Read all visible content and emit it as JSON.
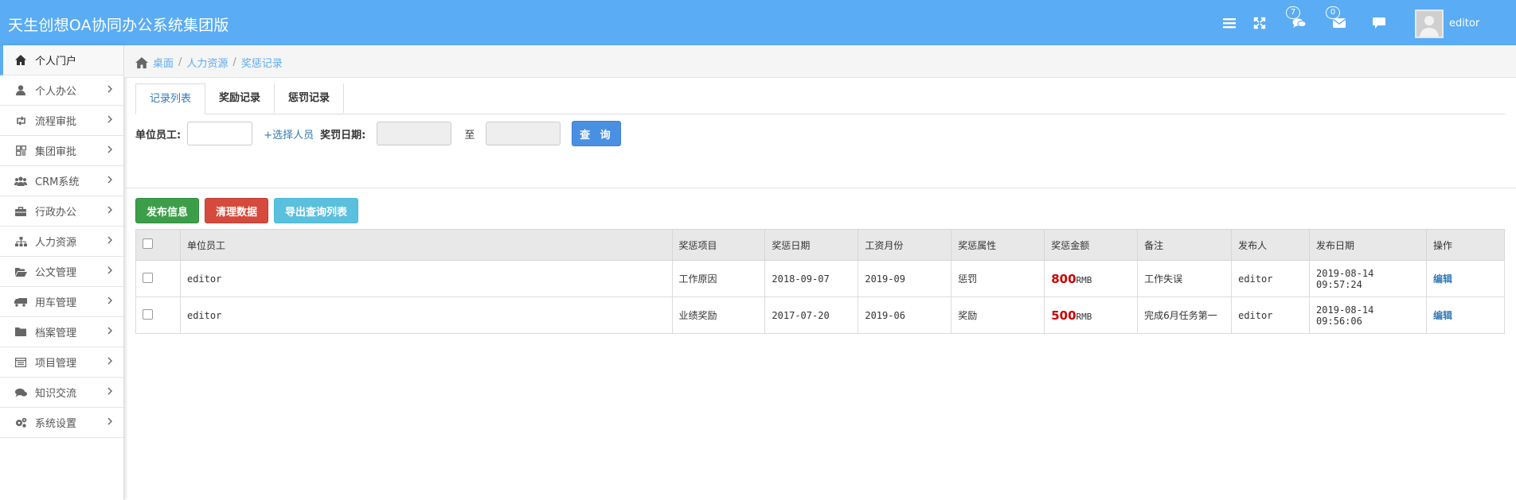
{
  "app": {
    "title": "天生创想OA协同办公系统集团版"
  },
  "header": {
    "icons": [
      "menu-icon",
      "fullscreen-icon",
      "chat-icon",
      "mail-icon",
      "message-icon"
    ],
    "chat_badge": "7",
    "mail_badge": "0",
    "user_name": "editor"
  },
  "sidebar": {
    "items": [
      {
        "label": "个人门户",
        "icon": "home-icon"
      },
      {
        "label": "个人办公",
        "icon": "user-icon"
      },
      {
        "label": "流程审批",
        "icon": "retweet-icon"
      },
      {
        "label": "集团审批",
        "icon": "grid-icon"
      },
      {
        "label": "CRM系统",
        "icon": "users-icon"
      },
      {
        "label": "行政办公",
        "icon": "briefcase-icon"
      },
      {
        "label": "人力资源",
        "icon": "sitemap-icon"
      },
      {
        "label": "公文管理",
        "icon": "folder-open-icon"
      },
      {
        "label": "用车管理",
        "icon": "truck-icon"
      },
      {
        "label": "档案管理",
        "icon": "folder-icon"
      },
      {
        "label": "项目管理",
        "icon": "list-icon"
      },
      {
        "label": "知识交流",
        "icon": "comments-icon"
      },
      {
        "label": "系统设置",
        "icon": "cogs-icon"
      }
    ]
  },
  "breadcrumb": [
    "桌面",
    "人力资源",
    "奖惩记录"
  ],
  "tabs": [
    "记录列表",
    "奖励记录",
    "惩罚记录"
  ],
  "filters": {
    "employee_label": "单位员工:",
    "pick_label": "+选择人员",
    "date_label": "奖罚日期:",
    "to_label": "至",
    "query_button": "查 询"
  },
  "actions": {
    "publish": "发布信息",
    "clear": "清理数据",
    "export": "导出查询列表"
  },
  "table": {
    "headers": [
      "单位员工",
      "奖惩项目",
      "奖惩日期",
      "工资月份",
      "奖惩属性",
      "奖惩金额",
      "备注",
      "发布人",
      "发布日期",
      "操作"
    ],
    "rows": [
      {
        "employee": "editor",
        "item": "工作原因",
        "date": "2018-09-07",
        "month": "2019-09",
        "type": "惩罚",
        "amount": "800",
        "unit": "RMB",
        "note": "工作失误",
        "publisher": "editor",
        "publish_date": "2019-08-14 09:57:24",
        "action": "编辑"
      },
      {
        "employee": "editor",
        "item": "业绩奖励",
        "date": "2017-07-20",
        "month": "2019-06",
        "type": "奖励",
        "amount": "500",
        "unit": "RMB",
        "note": "完成6月任务第一",
        "publisher": "editor",
        "publish_date": "2019-08-14 09:56:06",
        "action": "编辑"
      }
    ]
  },
  "colors": {
    "header": "#5aacf5",
    "reward": "#3a9a3a",
    "amount": "#cc0000"
  }
}
